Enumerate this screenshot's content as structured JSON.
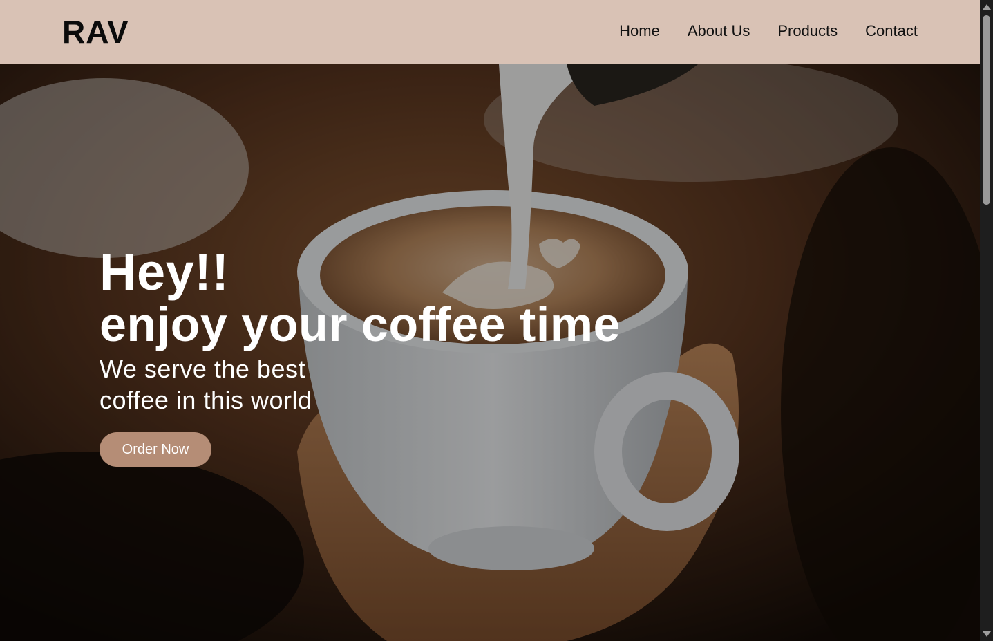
{
  "header": {
    "logo": "RAV",
    "nav": [
      {
        "label": "Home"
      },
      {
        "label": "About Us"
      },
      {
        "label": "Products"
      },
      {
        "label": "Contact"
      }
    ]
  },
  "hero": {
    "title_line1": "Hey!!",
    "title_line2": "enjoy your coffee time",
    "subtitle": "We serve the best coffee in this world",
    "cta": "Order Now"
  },
  "colors": {
    "header_bg": "#d9c2b5",
    "cta_bg": "#b58d76",
    "text_on_hero": "#ffffff"
  }
}
